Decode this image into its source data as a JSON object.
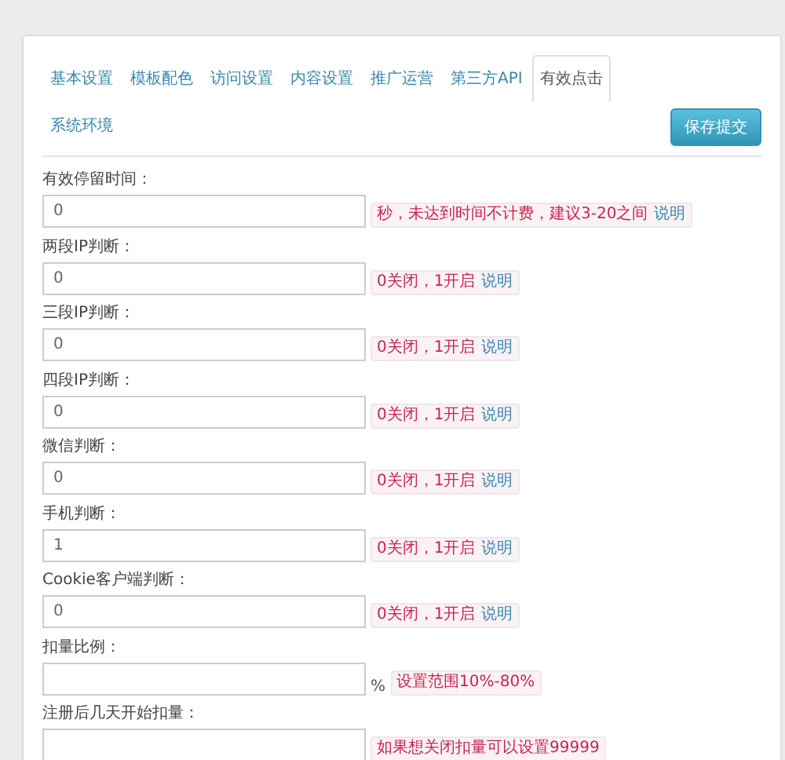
{
  "tabs": [
    {
      "label": "基本设置",
      "selected": false
    },
    {
      "label": "模板配色",
      "selected": false
    },
    {
      "label": "访问设置",
      "selected": false
    },
    {
      "label": "内容设置",
      "selected": false
    },
    {
      "label": "推广运营",
      "selected": false
    },
    {
      "label": "第三方API",
      "selected": false
    },
    {
      "label": "有效点击",
      "selected": true
    },
    {
      "label": "系统环境",
      "selected": false
    }
  ],
  "save_button": "保存提交",
  "fields": [
    {
      "label": "有效停留时间：",
      "value": "0",
      "hint": "秒，未达到时间不计费，建议3-20之间",
      "link": "说明"
    },
    {
      "label": "两段IP判断：",
      "value": "0",
      "hint": "0关闭，1开启",
      "link": "说明"
    },
    {
      "label": "三段IP判断：",
      "value": "0",
      "hint": "0关闭，1开启",
      "link": "说明"
    },
    {
      "label": "四段IP判断：",
      "value": "0",
      "hint": "0关闭，1开启",
      "link": "说明"
    },
    {
      "label": "微信判断：",
      "value": "0",
      "hint": "0关闭，1开启",
      "link": "说明"
    },
    {
      "label": "手机判断：",
      "value": "1",
      "hint": "0关闭，1开启",
      "link": "说明"
    },
    {
      "label": "Cookie客户端判断：",
      "value": "0",
      "hint": "0关闭，1开启",
      "link": "说明"
    },
    {
      "label": "扣量比例：",
      "unit": "%",
      "hint": "设置范围10%-80%"
    },
    {
      "label": "注册后几天开始扣量：",
      "hint": "如果想关闭扣量可以设置99999"
    }
  ]
}
